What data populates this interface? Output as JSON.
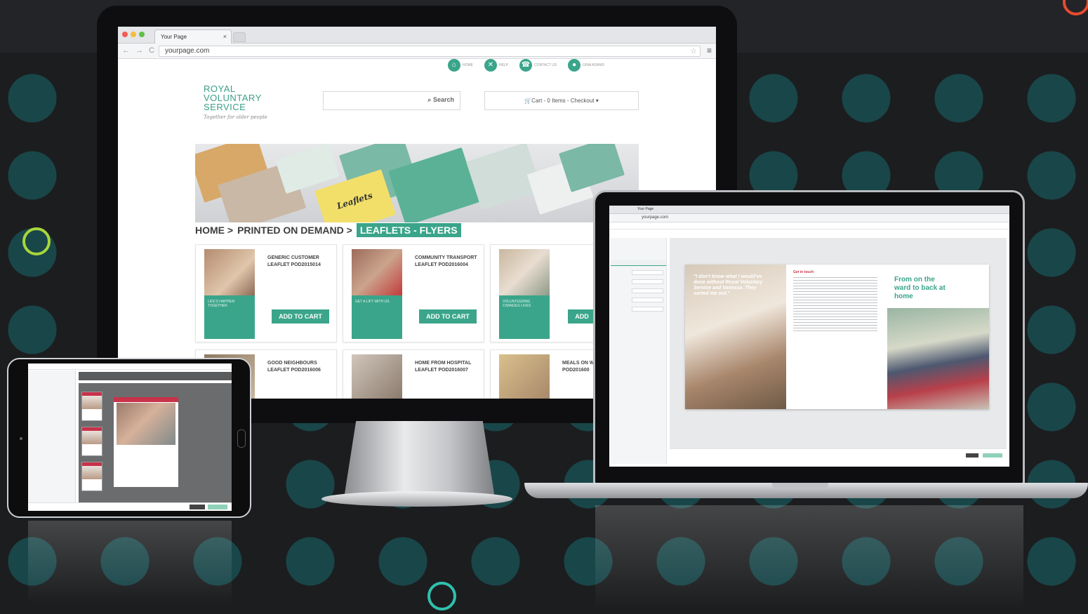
{
  "monitor": {
    "browser": {
      "tab_title": "Your Page",
      "tab_close": "×",
      "url": "yourpage.com"
    },
    "top_nav": [
      {
        "label": "HOME",
        "icon": "home-icon"
      },
      {
        "label": "HELP",
        "icon": "tools-icon"
      },
      {
        "label": "CONTACT US",
        "icon": "phone-icon"
      },
      {
        "label": "GINA ADAMS",
        "icon": "user-icon"
      }
    ],
    "logo": {
      "line1": "ROYAL",
      "line2": "VOLUNTARY",
      "line3": "SERVICE",
      "tagline": "Together for older people"
    },
    "search": {
      "label": "Search"
    },
    "cart": {
      "text": "Cart  - 0 Items  -  Checkout ▾"
    },
    "breadcrumb": {
      "home": "HOME >",
      "section": "PRINTED ON DEMAND >",
      "current": "LEAFLETS - FLYERS"
    },
    "products": [
      {
        "title": "GENERIC CUSTOMER LEAFLET POD2015014",
        "caption": "LIFE'S HAPPIER TOGETHER",
        "button": "ADD TO CART"
      },
      {
        "title": "COMMUNITY TRANSPORT LEAFLET POD2016004",
        "caption": "GET A LIFT WITH US",
        "button": "ADD TO CART"
      },
      {
        "title": "",
        "caption": "VOLUNTEERING CHANGES LIVES",
        "button": "ADD"
      },
      {
        "title": "GOOD NEIGHBOURS LEAFLET POD2016006",
        "caption": "",
        "button": ""
      },
      {
        "title": "HOME FROM HOSPITAL LEAFLET POD2016007",
        "caption": "",
        "button": ""
      },
      {
        "title": "MEALS ON W LEAFLET POD201600",
        "caption": "",
        "button": ""
      }
    ],
    "banner_label": "Leaflets"
  },
  "laptop": {
    "browser": {
      "tab_title": "Your Page",
      "url": "yourpage.com"
    },
    "brochure": {
      "quote": "\"I don't know what I would've done without Royal Voluntary Service and Vanessa. They sorted me out.\"",
      "heading": "From on the ward to back at home",
      "mid_heading": "Get in touch"
    }
  },
  "colors": {
    "brand": "#3aa58a",
    "accent_red": "#c8324a",
    "ring_green": "#a8d63a",
    "ring_teal": "#2fc0ad",
    "ring_orange": "#e84a2e"
  }
}
